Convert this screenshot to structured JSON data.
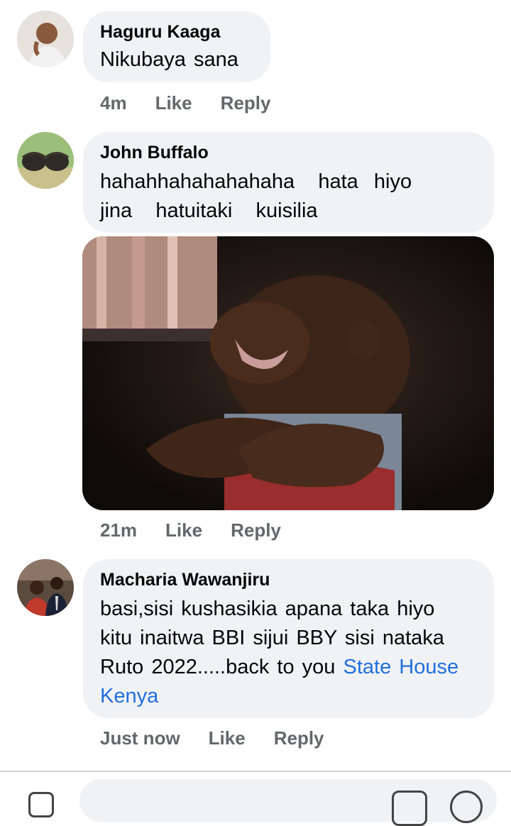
{
  "comments": [
    {
      "author": "Haguru Kaaga",
      "text": "Nikubaya sana",
      "time": "4m",
      "like": "Like",
      "reply": "Reply"
    },
    {
      "author": "John Buffalo",
      "text_line1": "hahahhahahahahaha   hata  hiyo",
      "text_line2": "jina   hatuitaki   kuisilia",
      "time": "21m",
      "like": "Like",
      "reply": "Reply"
    },
    {
      "author": "Macharia Wawanjiru",
      "text_line1": "basi,sisi kushasikia apana taka hiyo",
      "text_line2": "kitu inaitwa BBI sijui BBY sisi nataka",
      "text_line3": "Ruto 2022.....back to you ",
      "mention_part1": "State House",
      "mention_part2": "Kenya",
      "time": "Just now",
      "like": "Like",
      "reply": "Reply"
    }
  ],
  "colors": {
    "bubble": "#f0f2f5",
    "link": "#216fdb",
    "meta": "#65676b"
  },
  "icons": [
    "camera-icon",
    "sticker-icon",
    "emoji-icon"
  ]
}
